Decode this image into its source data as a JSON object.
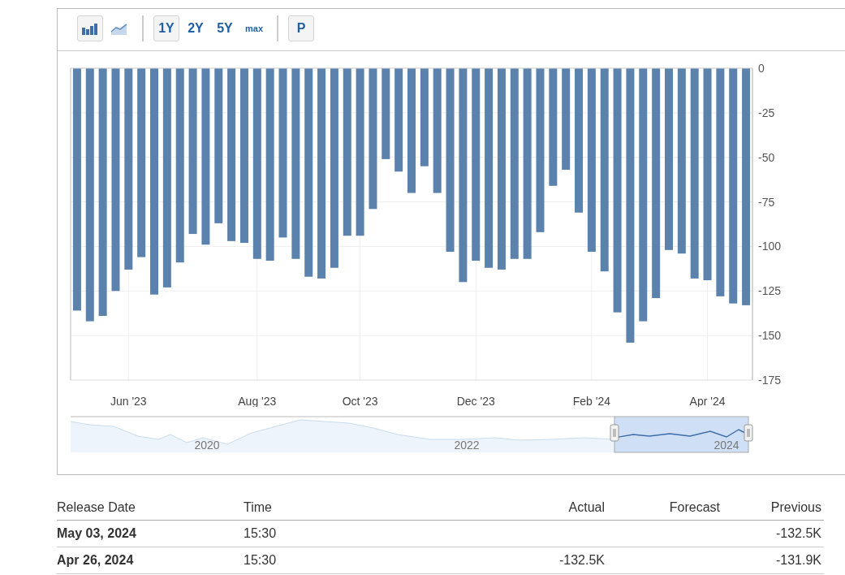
{
  "toolbar": {
    "chart_types": [
      {
        "kind": "bar",
        "selected": true
      },
      {
        "kind": "line",
        "selected": false
      }
    ],
    "ranges": [
      {
        "label": "1Y",
        "selected": true
      },
      {
        "label": "2Y",
        "selected": false
      },
      {
        "label": "5Y",
        "selected": false
      },
      {
        "label": "max",
        "selected": false
      }
    ],
    "extra_button": "P"
  },
  "chart": {
    "chart_data": {
      "type": "bar",
      "categories": [
        null,
        null,
        null,
        null,
        "Jun '23",
        null,
        null,
        null,
        null,
        null,
        null,
        null,
        null,
        null,
        "Aug '23",
        null,
        null,
        null,
        null,
        null,
        null,
        null,
        "Oct '23",
        null,
        null,
        null,
        null,
        null,
        null,
        null,
        null,
        "Dec '23",
        null,
        null,
        null,
        null,
        null,
        null,
        null,
        null,
        "Feb '24",
        null,
        null,
        null,
        null,
        null,
        null,
        null,
        null,
        "Apr '24",
        null,
        null,
        null
      ],
      "series": [
        {
          "color": "#5b82ad",
          "values": [
            -136,
            -142,
            -139,
            -125,
            -113,
            -106,
            -127,
            -123,
            -109,
            -93,
            -99,
            -87,
            -97,
            -98,
            -107,
            -108,
            -95,
            -107,
            -117,
            -118,
            -112,
            -94,
            -94,
            -79,
            -51,
            -58,
            -70,
            -55,
            -70,
            -103,
            -120,
            -108,
            -112,
            -113,
            -107,
            -107,
            -92,
            -66,
            -57,
            -81,
            -103,
            -114,
            -137,
            -154,
            -142,
            -129,
            -102,
            -104,
            -118,
            -119,
            -128,
            -132,
            -133
          ]
        }
      ],
      "grid": true,
      "ylim": [
        -175,
        0
      ],
      "yticks": [
        0,
        -25,
        -50,
        -75,
        -100,
        -125,
        -150,
        -175
      ]
    }
  },
  "navigator": {
    "labels": [
      "2020",
      "2022",
      "2024"
    ]
  },
  "table": {
    "columns": [
      "Release Date",
      "Time",
      "Actual",
      "Forecast",
      "Previous"
    ],
    "rows": [
      [
        "May 03, 2024",
        "15:30",
        "",
        "",
        "-132.5K"
      ],
      [
        "Apr 26, 2024",
        "15:30",
        "-132.5K",
        "",
        "-131.9K"
      ]
    ]
  }
}
